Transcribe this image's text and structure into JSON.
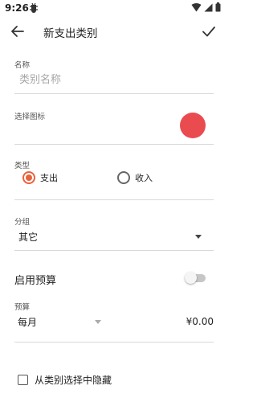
{
  "status_bar": {
    "time": "9:26"
  },
  "app_bar": {
    "title": "新支出类别"
  },
  "name_field": {
    "label": "名称",
    "placeholder": "类别名称",
    "value": ""
  },
  "icon_picker": {
    "label": "选择图标",
    "color": "#ea4b4f"
  },
  "type": {
    "label": "类型",
    "options": [
      {
        "label": "支出",
        "checked": true
      },
      {
        "label": "收入",
        "checked": false
      }
    ]
  },
  "group": {
    "label": "分组",
    "value": "其它"
  },
  "budget": {
    "enable_label": "启用预算",
    "enabled": false,
    "label": "预算",
    "period": "每月",
    "amount": "¥0.00"
  },
  "hide_option": {
    "label": "从类别选择中隐藏",
    "checked": false
  },
  "accent_color": "#e8623e"
}
